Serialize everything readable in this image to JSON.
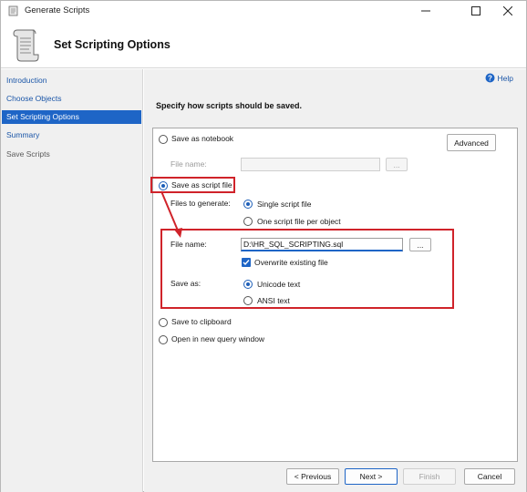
{
  "window": {
    "title": "Generate Scripts"
  },
  "header": {
    "title": "Set Scripting Options"
  },
  "sidebar": {
    "items": [
      {
        "label": "Introduction",
        "state": "link"
      },
      {
        "label": "Choose Objects",
        "state": "link"
      },
      {
        "label": "Set Scripting Options",
        "state": "active"
      },
      {
        "label": "Summary",
        "state": "link"
      },
      {
        "label": "Save Scripts",
        "state": "disabled"
      }
    ]
  },
  "help": {
    "label": "Help"
  },
  "instruction": "Specify how scripts should be saved.",
  "options": {
    "save_notebook": {
      "label": "Save as notebook",
      "selected": false
    },
    "notebook_file_label": "File name:",
    "notebook_browse": "...",
    "advanced": "Advanced",
    "save_script_file": {
      "label": "Save as script file",
      "selected": true
    },
    "files_to_generate_label": "Files to generate:",
    "single_script": {
      "label": "Single script file",
      "selected": true
    },
    "one_per_object": {
      "label": "One script file per object",
      "selected": false
    },
    "file_name_label": "File name:",
    "file_name_value": "D:\\HR_SQL_SCRIPTING.sql",
    "browse": "...",
    "overwrite": {
      "label": "Overwrite existing file",
      "checked": true
    },
    "save_as_label": "Save as:",
    "unicode": {
      "label": "Unicode text",
      "selected": true
    },
    "ansi": {
      "label": "ANSI text",
      "selected": false
    },
    "clipboard": {
      "label": "Save to clipboard",
      "selected": false
    },
    "query_window": {
      "label": "Open in new query window",
      "selected": false
    }
  },
  "footer": {
    "previous": "< Previous",
    "next": "Next >",
    "finish": "Finish",
    "cancel": "Cancel"
  },
  "colors": {
    "accent": "#1e65c6",
    "highlight": "#d0232a",
    "link": "#1b56a8"
  }
}
